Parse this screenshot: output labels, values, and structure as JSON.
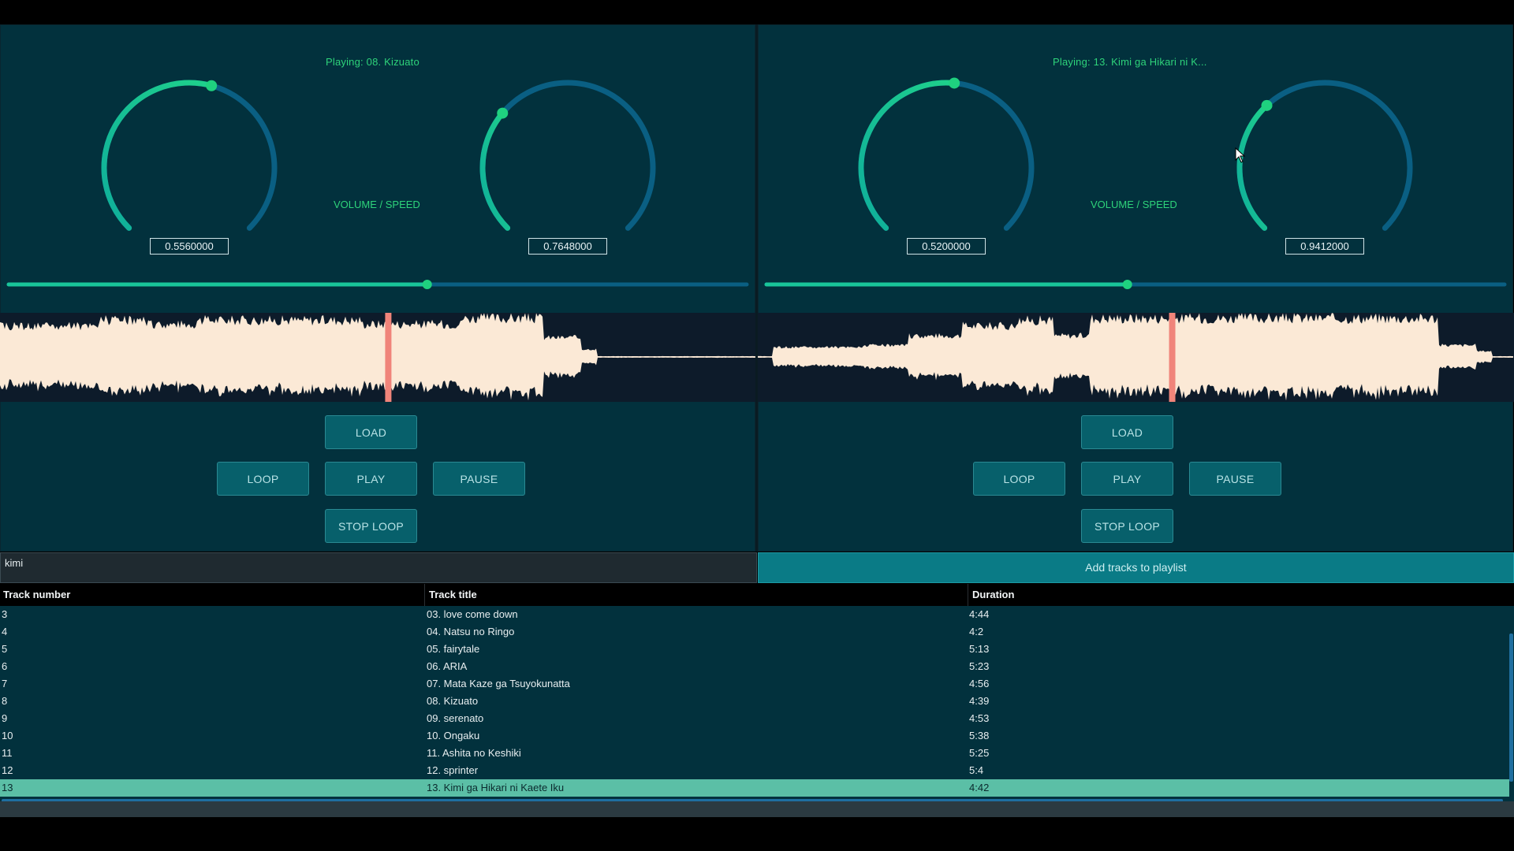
{
  "left_deck": {
    "now_playing": "Playing: 08. Kizuato",
    "knob_label": "VOLUME / SPEED",
    "volume_value": "0.5560000",
    "speed_value": "0.7648000",
    "volume_level": 0.556,
    "speed_level": 0.7648,
    "position_level": 0.567,
    "buttons": {
      "load": "LOAD",
      "loop": "LOOP",
      "play": "PLAY",
      "pause": "PAUSE",
      "stop_loop": "STOP LOOP"
    }
  },
  "right_deck": {
    "now_playing": "Playing: 13. Kimi ga Hikari ni K...",
    "knob_label": "VOLUME / SPEED",
    "volume_value": "0.5200000",
    "speed_value": "0.9412000",
    "volume_level": 0.52,
    "speed_level": 0.9412,
    "position_level": 0.489,
    "buttons": {
      "load": "LOAD",
      "loop": "LOOP",
      "play": "PLAY",
      "pause": "PAUSE",
      "stop_loop": "STOP LOOP"
    }
  },
  "playlist": {
    "search_value": "kimi",
    "add_button": "Add tracks to playlist",
    "columns": [
      "Track number",
      "Track title",
      "Duration"
    ],
    "rows": [
      {
        "num": "3",
        "title": "03. love come down",
        "duration": "4:44"
      },
      {
        "num": "4",
        "title": "04. Natsu no Ringo",
        "duration": "4:2"
      },
      {
        "num": "5",
        "title": "05. fairytale",
        "duration": "5:13"
      },
      {
        "num": "6",
        "title": "06. ARIA",
        "duration": "5:23"
      },
      {
        "num": "7",
        "title": "07. Mata Kaze ga Tsuyokunatta",
        "duration": "4:56"
      },
      {
        "num": "8",
        "title": "08. Kizuato",
        "duration": "4:39"
      },
      {
        "num": "9",
        "title": "09. serenato",
        "duration": "4:53"
      },
      {
        "num": "10",
        "title": "10. Ongaku",
        "duration": "5:38"
      },
      {
        "num": "11",
        "title": "11. Ashita no Keshiki",
        "duration": "5:25"
      },
      {
        "num": "12",
        "title": "12. sprinter",
        "duration": "5:4"
      },
      {
        "num": "13",
        "title": "13. Kimi ga Hikari ni Kaete Iku",
        "duration": "4:42"
      }
    ],
    "selected_index": 10
  },
  "colors": {
    "deck_bg": "#02313d",
    "accent": "#19c59a",
    "knob_track": "#0a5f83",
    "waveform": "#fbe9d6",
    "playhead": "#f0847a"
  }
}
